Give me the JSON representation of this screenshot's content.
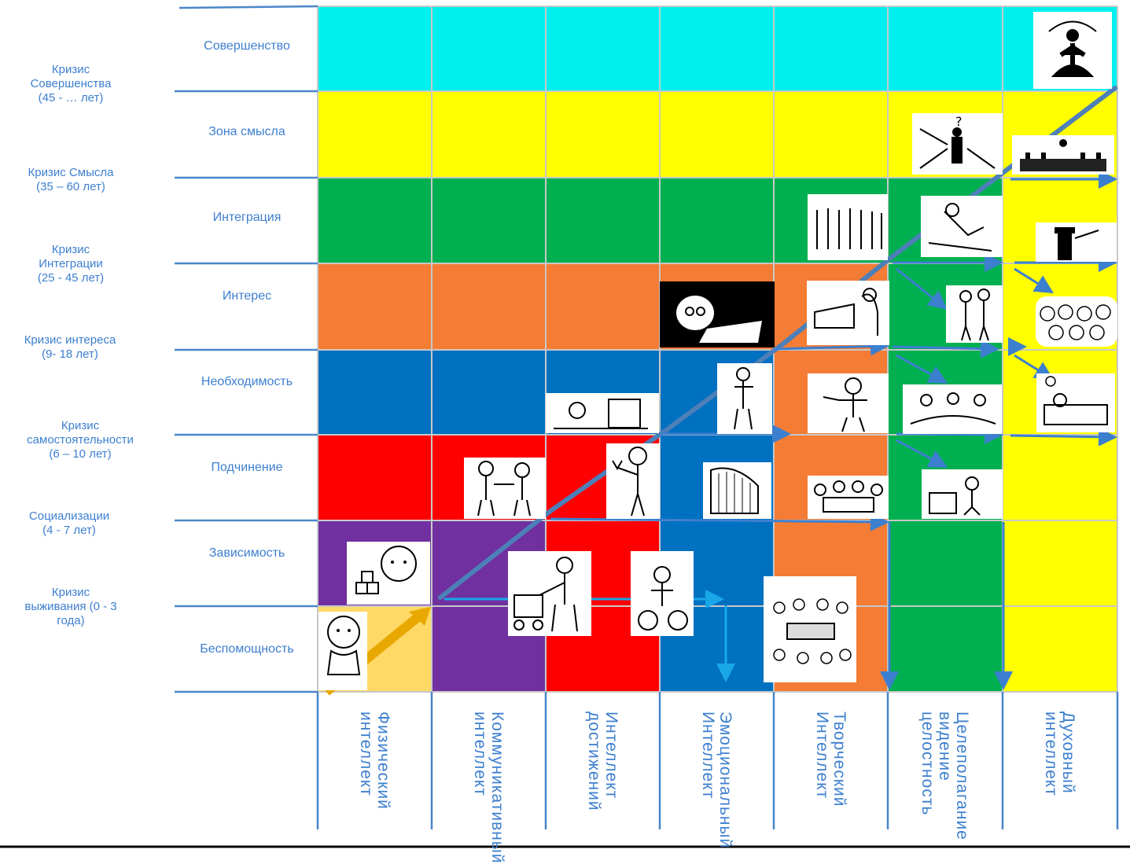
{
  "rows": [
    {
      "label": "Совершенство",
      "color": "#00f0f0"
    },
    {
      "label": "Зона смысла",
      "color": "#ffff00"
    },
    {
      "label": "Интеграция",
      "color": "#00b050"
    },
    {
      "label": "Интерес",
      "color": "#f47c35"
    },
    {
      "label": "Необходимость",
      "color": "#0070c0"
    },
    {
      "label": "Подчинение",
      "color": "#ff0000"
    },
    {
      "label": "Зависимость",
      "color": "#7030a0"
    },
    {
      "label": "Беспомощность",
      "color": "#ffd966"
    }
  ],
  "crises": [
    {
      "text": "Кризис\nСовершенства\n(45  - … лет)"
    },
    {
      "text": "Кризис Смысла\n(35 – 60 лет)"
    },
    {
      "text": "Кризис\nИнтеграции\n(25 - 45 лет)"
    },
    {
      "text": "Кризис интереса\n(9- 18 лет)"
    },
    {
      "text": "Кризис\nсамостоятельности\n(6 – 10 лет)"
    },
    {
      "text": "Социализации\n(4 - 7 лет)"
    },
    {
      "text": "Кризис\nвыживания (0 - 3\nгода)"
    }
  ],
  "columns": [
    {
      "label": "Физический\nинтеллект"
    },
    {
      "label": "Коммуникативный\nинтеллект"
    },
    {
      "label": "Интеллект\nдостижений"
    },
    {
      "label": "Эмоциональный\nИнтеллект"
    },
    {
      "label": "Творческий\nИнтеллект"
    },
    {
      "label": "Целеполагание\nвидение\nцелостность"
    },
    {
      "label": "Духовный\nинтеллект"
    }
  ],
  "grid_colors": [
    [
      "#00f0f0",
      "#00f0f0",
      "#00f0f0",
      "#00f0f0",
      "#00f0f0",
      "#00f0f0",
      "#00f0f0"
    ],
    [
      "#ffff00",
      "#ffff00",
      "#ffff00",
      "#ffff00",
      "#ffff00",
      "#ffff00",
      "#ffff00"
    ],
    [
      "#00b050",
      "#00b050",
      "#00b050",
      "#00b050",
      "#00b050",
      "#00b050",
      "#ffff00"
    ],
    [
      "#f47c35",
      "#f47c35",
      "#f47c35",
      "#f47c35",
      "#f47c35",
      "#00b050",
      "#ffff00"
    ],
    [
      "#0070c0",
      "#0070c0",
      "#0070c0",
      "#0070c0",
      "#f47c35",
      "#00b050",
      "#ffff00"
    ],
    [
      "#ff0000",
      "#ff0000",
      "#ff0000",
      "#0070c0",
      "#f47c35",
      "#00b050",
      "#ffff00"
    ],
    [
      "#7030a0",
      "#7030a0",
      "#ff0000",
      "#0070c0",
      "#f47c35",
      "#00b050",
      "#ffff00"
    ],
    [
      "#ffd966",
      "#7030a0",
      "#ff0000",
      "#0070c0",
      "#f47c35",
      "#00b050",
      "#ffff00"
    ]
  ],
  "illustrations": [
    {
      "name": "meditation-figure-illustration"
    },
    {
      "name": "questioning-man-illustration"
    },
    {
      "name": "audience-speaker-illustration"
    },
    {
      "name": "group-of-people-illustration"
    },
    {
      "name": "skier-illustration"
    },
    {
      "name": "magician-illustration"
    },
    {
      "name": "reading-boy-illustration"
    },
    {
      "name": "desk-work-illustration"
    },
    {
      "name": "hiking-couple-illustration"
    },
    {
      "name": "crowd-faces-illustration"
    },
    {
      "name": "studying-child-illustration"
    },
    {
      "name": "standing-boy-illustration"
    },
    {
      "name": "mechanic-illustration"
    },
    {
      "name": "team-work-illustration"
    },
    {
      "name": "sick-child-illustration"
    },
    {
      "name": "children-playing-illustration"
    },
    {
      "name": "slingshot-boy-illustration"
    },
    {
      "name": "harp-player-illustration"
    },
    {
      "name": "family-dinner-illustration"
    },
    {
      "name": "kitchen-scene-illustration"
    },
    {
      "name": "baby-blocks-illustration"
    },
    {
      "name": "mother-stroller-illustration"
    },
    {
      "name": "child-on-bike-illustration"
    },
    {
      "name": "meeting-crowd-illustration"
    },
    {
      "name": "infant-illustration"
    }
  ]
}
